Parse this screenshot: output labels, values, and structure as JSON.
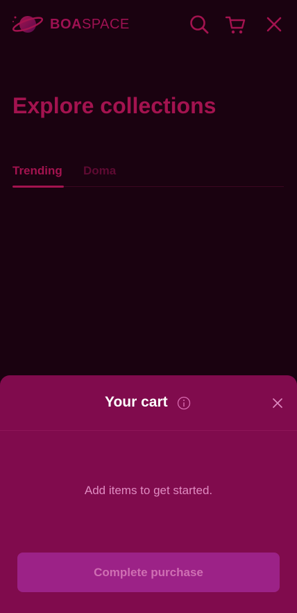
{
  "header": {
    "logo_text_bold": "BOA",
    "logo_text_light": "SPACE",
    "icons": [
      "search-icon",
      "cart-icon",
      "close-icon"
    ]
  },
  "main": {
    "title": "Explore collections",
    "tabs": [
      {
        "label": "Trending",
        "active": true
      },
      {
        "label": "Doma",
        "active": false
      }
    ]
  },
  "cart": {
    "title": "Your cart",
    "empty_message": "Add items to get started.",
    "complete_button": "Complete purchase"
  },
  "colors": {
    "background": "#1a0210",
    "accent": "#a3134f",
    "sheet": "#800b4d",
    "button": "#9c2287"
  }
}
